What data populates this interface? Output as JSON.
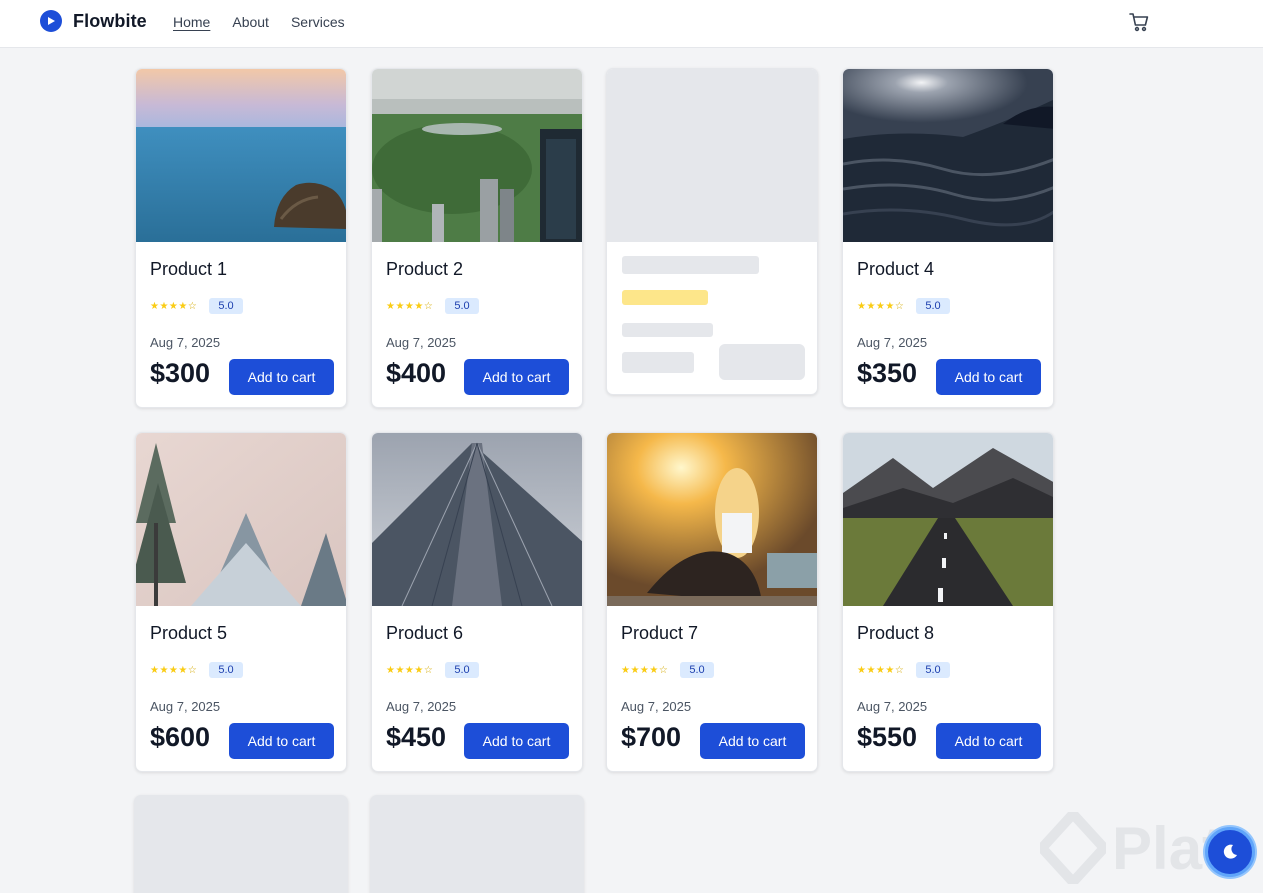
{
  "brand": {
    "name": "Flowbite",
    "logo_icon": "play-circle-icon",
    "color": "#1d4ed8"
  },
  "nav": {
    "home": "Home",
    "about": "About",
    "services": "Services",
    "cart_icon": "cart-icon"
  },
  "products": [
    {
      "title": "Product 1",
      "rating": "5.0",
      "date": "Aug 7, 2025",
      "price": "$300",
      "button": "Add to cart",
      "image": "sea-with-rock"
    },
    {
      "title": "Product 2",
      "rating": "5.0",
      "date": "Aug 7, 2025",
      "price": "$400",
      "button": "Add to cart",
      "image": "city-park-aerial"
    },
    {
      "loading": true
    },
    {
      "title": "Product 4",
      "rating": "5.0",
      "date": "Aug 7, 2025",
      "price": "$350",
      "button": "Add to cart",
      "image": "dark-ocean-waves"
    },
    {
      "title": "Product 5",
      "rating": "5.0",
      "date": "Aug 7, 2025",
      "price": "$600",
      "button": "Add to cart",
      "image": "snowy-pine-trees"
    },
    {
      "title": "Product 6",
      "rating": "5.0",
      "date": "Aug 7, 2025",
      "price": "$450",
      "button": "Add to cart",
      "image": "skyscraper-upward"
    },
    {
      "title": "Product 7",
      "rating": "5.0",
      "date": "Aug 7, 2025",
      "price": "$700",
      "button": "Add to cart",
      "image": "woman-sunset"
    },
    {
      "title": "Product 8",
      "rating": "5.0",
      "date": "Aug 7, 2025",
      "price": "$550",
      "button": "Add to cart",
      "image": "mountain-road"
    },
    {
      "loading": true
    },
    {
      "loading": true
    }
  ],
  "watermark": {
    "text": "Plat"
  },
  "dark_mode_toggle": {
    "icon": "moon-icon"
  }
}
